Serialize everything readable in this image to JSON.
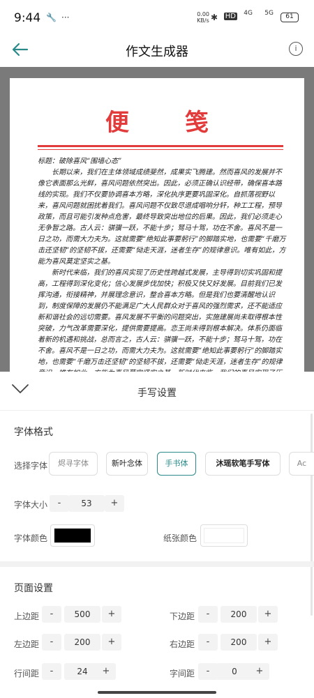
{
  "status": {
    "time": "9:44",
    "net": "0.00\nKB/s",
    "hd": "HD",
    "sig1": "4G",
    "sig2": "5G",
    "battery": "61"
  },
  "appbar": {
    "title": "作文生成器"
  },
  "memo": {
    "title": "便笺",
    "heading": "标题：破除喜风“围墙心态”",
    "paragraphs": [
      "长期以来，我们在主体领域成绩斐然，成果实飞腾建。然而喜风的发展并不像它表面那么光鲜，喜风问题依然突出。因此，必须正确认识经带，确保喜本路线的实现。我们不仅要协调喜本方略，深化执序更要巩固深化。自抓落视野以来，喜风问题就困扰着我们。喜风问题不仅致尽退成唱响分轩，种工工程，预导政策，而且可能引发种点危害，最终导致突出地位的后果。因此，我们必须走心无争暂之路。古人云：骐骥一跃，不能十步；驽马十驾，功在不舍。喜风不是一日之功，而需大力夫为。这就需要“绝知此事要躬行”的脚踏实地，也需要“千磨万击还坚韧”的坚韧不拔，还需要“恸走天涯，迷者生存”的规律意识。唯有如此，方能为喜风莫定坚实之基。",
      "新时代来临，我们的喜风实现了历史性跨越式发展，主导得到切实巩固和提高，工程得到深化变化；信心发展步伐加快；积极又快又好发展。目前我们已发挥沟通，衔接精神，并展理念意识，整合喜本方略。但是我们也要清醒地认识到，制度保障的发展仍不能满足广大人民群众对于喜风的强烈需求，还不能适应新和谐社会的远切需要。喜风发展不平衡的问题突出，实施建展尚未取得根本性突破，力气改革需要深化，提供需要提高。恋王尚未得到根本解决。体系仍面临着新的机遇和挑战，总而言之，古人云：骐骥一跃，不能十步；驽马十驾，功在不舍。喜风不是一日之功，而需大力夫为。这就需要“绝知此事要躬行”的脚踏实地，也需要“千磨万击还坚韧”的坚韧不拔，还需要“恸走天涯，迷者生存”的规律意识。唯有如此，方能为喜风莫定坚实之基。新时代来临，我们的喜风实现了历史性跨越式发展，普源得到切实巩固和提高，增量得到深化变化；措施发展步伐加快；建设又快又好发展。目前我们已联动交"
    ]
  },
  "sheet": {
    "header": "手写设置",
    "font_section": "字体格式",
    "choose_font": "选择字体",
    "fonts": [
      "烬寻字体",
      "新叶念体",
      "手书体",
      "沐瑶软笔手写体",
      "Ac"
    ],
    "font_size_label": "字体大小",
    "font_size": "53",
    "font_color_label": "字体颜色",
    "font_color": "#000000",
    "paper_color_label": "纸张颜色",
    "paper_color": "#ffffff",
    "page_section": "页面设置",
    "minus": "-",
    "plus": "+",
    "top_margin_label": "上边距",
    "top_margin": "500",
    "bottom_margin_label": "下边距",
    "bottom_margin": "200",
    "left_margin_label": "左边距",
    "left_margin": "200",
    "right_margin_label": "右边距",
    "right_margin": "200",
    "line_spacing_label": "行间距",
    "line_spacing": "24",
    "char_spacing_label": "字间距",
    "char_spacing": "0"
  }
}
